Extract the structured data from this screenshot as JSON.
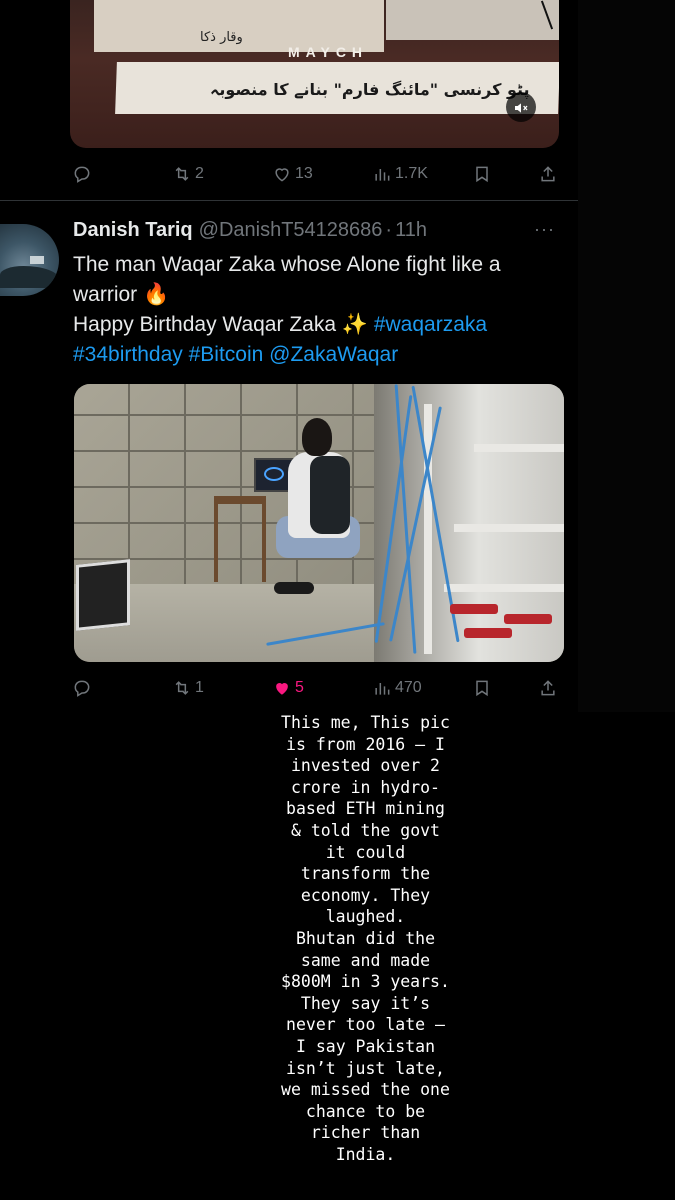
{
  "video": {
    "brand": "MAYCH",
    "caption_small": "وقار ذکا",
    "caption_main": "پٹو کرنسی \"مائنگ فارم\" بنانے کا منصوبہ",
    "mute_icon": "speaker-mute-icon"
  },
  "post1_actions": {
    "replies": "",
    "reposts": "2",
    "likes": "13",
    "views": "1.7K"
  },
  "tweet": {
    "author_name": "Danish Tariq",
    "handle": "@DanishT54128686",
    "dot": "·",
    "time": "11h",
    "more": "···",
    "line1": "The man Waqar Zaka whose Alone fight like a",
    "line2": "warrior 🔥",
    "line3_text": "Happy Birthday Waqar Zaka ✨ ",
    "tag1": "#waqarzaka",
    "tag2": "#34birthday",
    "tag3": "#Bitcoin",
    "mention": "@ZakaWaqar"
  },
  "post2_actions": {
    "replies": "",
    "reposts": "1",
    "likes": "5",
    "views": "470"
  },
  "colors": {
    "accent": "#1d9bf0",
    "like": "#f91880",
    "muted": "#71767b"
  },
  "story_caption": [
    "This me, This pic",
    "is from 2016 — I",
    "invested over 2",
    "crore in hydro-",
    "based ETH mining",
    "& told the govt",
    "it could",
    "transform the",
    "economy. They",
    "laughed.",
    "Bhutan did the",
    "same and made",
    "$800M in 3 years.",
    "They say it’s",
    "never too late —",
    "I say Pakistan",
    "isn’t just late,",
    "we missed the one",
    "chance to be",
    "richer than",
    "India."
  ]
}
